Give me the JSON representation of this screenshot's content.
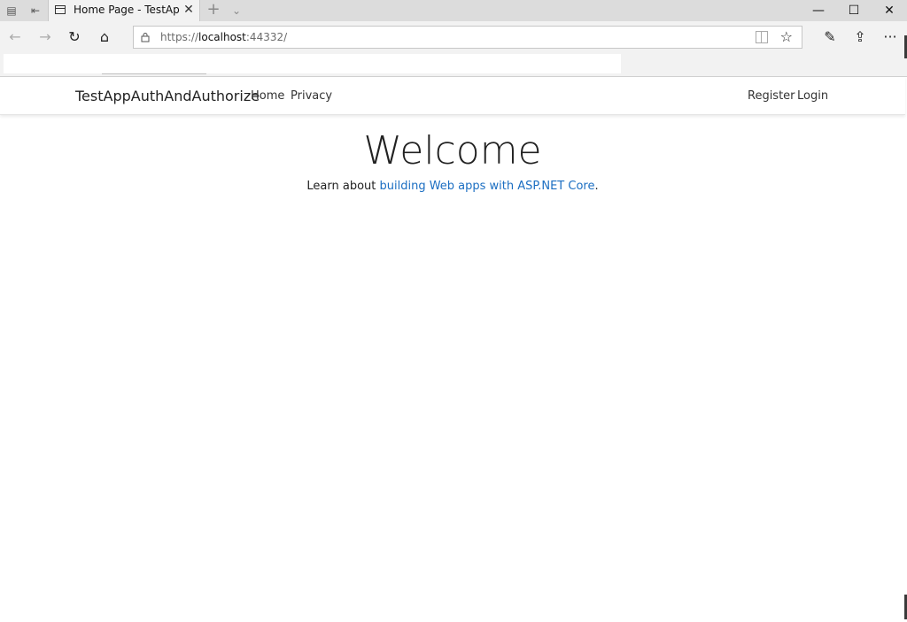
{
  "browser": {
    "tab": {
      "title": "Home Page - TestAppAuthAndAuthorize",
      "close_label": "✕"
    },
    "new_tab_label": "+",
    "tab_list_label": "⌄",
    "window": {
      "minimize": "—",
      "maximize": "☐",
      "close": "✕"
    },
    "address": {
      "url_prefix": "https://",
      "url_host": "localhost",
      "url_rest": ":44332/"
    },
    "toolbar": {
      "back": "←",
      "forward": "→",
      "refresh": "↻",
      "home": "⌂",
      "favorite": "☆",
      "notes": "✎",
      "share": "⇪",
      "more": "···"
    }
  },
  "site": {
    "brand": "TestAppAuthAndAuthorize",
    "nav": {
      "home": "Home",
      "privacy": "Privacy"
    },
    "auth": {
      "register": "Register",
      "login": "Login"
    }
  },
  "main": {
    "heading": "Welcome",
    "learn_prefix": "Learn about ",
    "learn_link": "building Web apps with ASP.NET Core",
    "learn_suffix": "."
  },
  "colors": {
    "link": "#1b6ec2",
    "chrome": "#f2f2f2",
    "titlebar": "#dcdcdc"
  }
}
